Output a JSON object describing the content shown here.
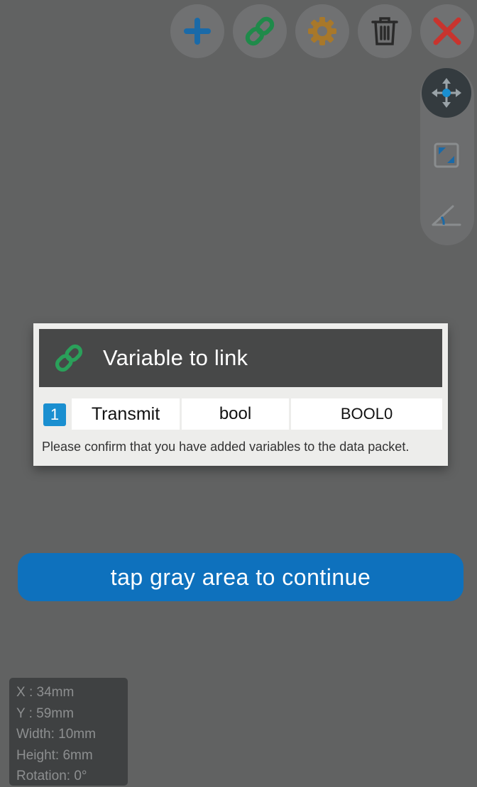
{
  "toolbar": {
    "buttons": [
      {
        "name": "add",
        "icon": "plus-icon",
        "color": "#1a6aa8"
      },
      {
        "name": "link",
        "icon": "link-icon",
        "color": "#1f8a4a"
      },
      {
        "name": "settings",
        "icon": "gear-icon",
        "color": "#a8782a"
      },
      {
        "name": "delete",
        "icon": "trash-icon",
        "color": "#2a2a2a"
      },
      {
        "name": "close",
        "icon": "close-icon",
        "color": "#c8342e"
      }
    ]
  },
  "mode_panel": {
    "items": [
      {
        "name": "move",
        "icon": "move-arrows-icon",
        "active": true
      },
      {
        "name": "resize",
        "icon": "resize-icon",
        "active": false
      },
      {
        "name": "rotate",
        "icon": "angle-icon",
        "active": false
      }
    ]
  },
  "dialog": {
    "title": "Variable to link",
    "icon": "link-icon",
    "rows": [
      {
        "index": "1",
        "direction": "Transmit",
        "type": "bool",
        "name": "BOOL0"
      }
    ],
    "note": "Please confirm that you have added variables to the data packet."
  },
  "banner": {
    "text": "tap gray area to continue",
    "color": "#0e71bd"
  },
  "info": {
    "x": "X  : 34mm",
    "y": "Y  : 59mm",
    "width": "Width: 10mm",
    "height": "Height: 6mm",
    "rotation": "Rotation: 0°"
  }
}
